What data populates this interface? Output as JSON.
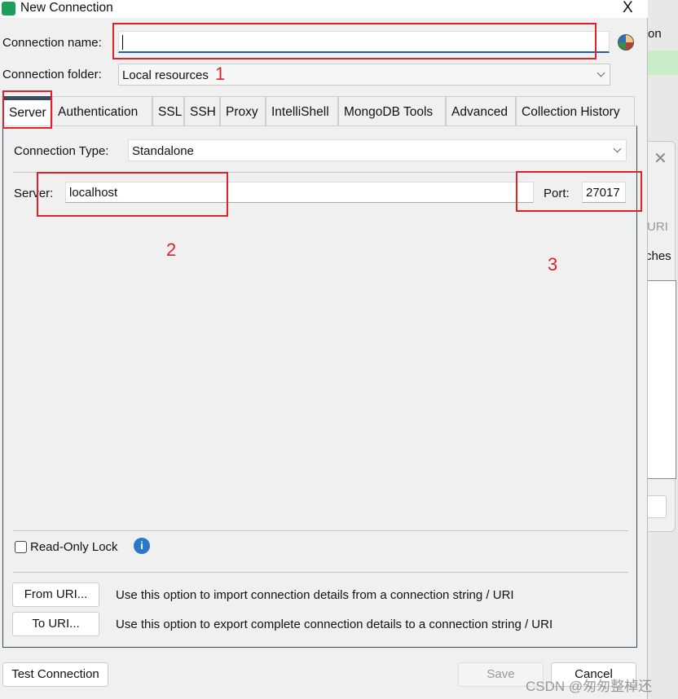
{
  "dialog": {
    "title": "New Connection",
    "close_label": "X"
  },
  "form": {
    "connection_name_label": "Connection name:",
    "connection_name_value": "",
    "connection_folder_label": "Connection folder:",
    "connection_folder_value": "Local resources"
  },
  "tabs": [
    {
      "label": "Server",
      "active": true
    },
    {
      "label": "Authentication"
    },
    {
      "label": "SSL"
    },
    {
      "label": "SSH"
    },
    {
      "label": "Proxy"
    },
    {
      "label": "IntelliShell"
    },
    {
      "label": "MongoDB Tools"
    },
    {
      "label": "Advanced"
    },
    {
      "label": "Collection History"
    }
  ],
  "server_tab": {
    "connection_type_label": "Connection Type:",
    "connection_type_value": "Standalone",
    "server_label": "Server:",
    "server_value": "localhost",
    "port_label": "Port:",
    "port_value": "27017",
    "readonly_label": "Read-Only Lock",
    "readonly_checked": false,
    "from_uri_label": "From URI...",
    "from_uri_desc": "Use this option to import connection details from a connection string / URI",
    "to_uri_label": "To URI...",
    "to_uri_desc": "Use this option to export complete connection details to a connection string / URI"
  },
  "footer": {
    "test_label": "Test Connection",
    "save_label": "Save",
    "cancel_label": "Cancel"
  },
  "annotations": {
    "one": "1",
    "two": "2",
    "three": "3",
    "color": "#e0202a"
  },
  "background_window": {
    "text_on": "on",
    "text_uri": "URI",
    "text_ches": "ches"
  },
  "watermark": "CSDN @匆匆整棹还",
  "colors": {
    "accent": "#1a5fb4",
    "tab_indicator": "#3b4b5e",
    "info": "#2a78c8"
  }
}
